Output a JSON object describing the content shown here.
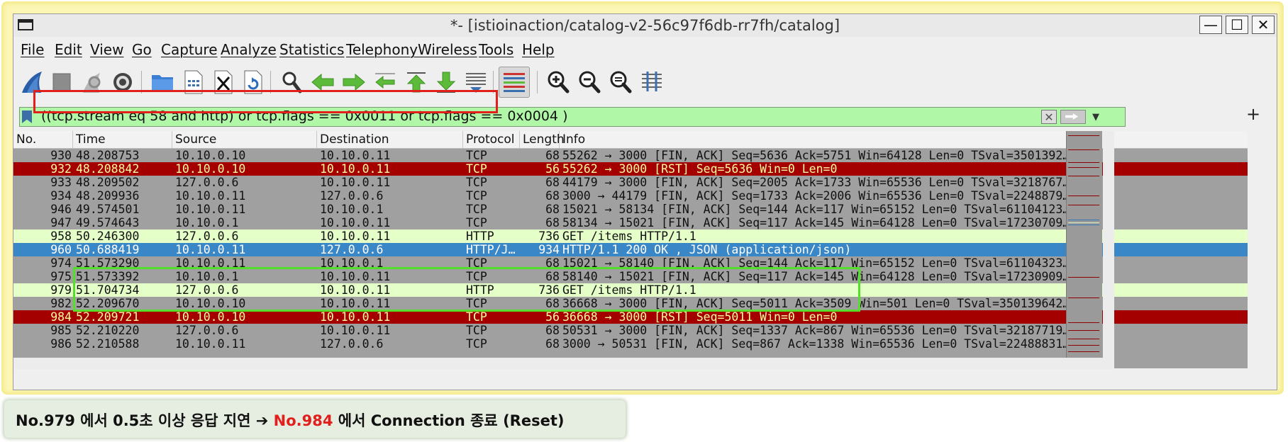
{
  "window": {
    "title": "*- [istioinaction/catalog-v2-56c97f6db-rr7fh/catalog]",
    "buttons": {
      "minimize": "—",
      "maximize": "☐",
      "close": "✕"
    }
  },
  "menu": [
    "File",
    "Edit",
    "View",
    "Go",
    "Capture",
    "Analyze",
    "Statistics",
    "Telephony",
    "Wireless",
    "Tools",
    "Help"
  ],
  "toolbar": {
    "icons": [
      "shark-fin-start-icon",
      "stop-icon",
      "restart-icon",
      "options-gear-icon",
      "open-folder-icon",
      "save-file-icon",
      "close-file-icon",
      "reload-icon",
      "find-icon",
      "back-arrow-icon",
      "forward-arrow-icon",
      "go-to-packet-icon",
      "first-packet-icon",
      "last-packet-icon",
      "autoscroll-icon",
      "colorize-icon",
      "zoom-in-icon",
      "zoom-out-icon",
      "normal-size-icon",
      "resize-columns-icon"
    ]
  },
  "filter": {
    "text": "((tcp.stream eq 58 and http) or tcp.flags == 0x0011 or tcp.flags == 0x0004 )",
    "plus": "+"
  },
  "columns": [
    "No.",
    "Time",
    "Source",
    "Destination",
    "Protocol",
    "Length",
    "Info"
  ],
  "packets": [
    {
      "no": "930",
      "time": "48.208753",
      "src": "10.10.0.10",
      "dst": "10.10.0.11",
      "proto": "TCP",
      "len": "68",
      "info": "55262 → 3000 [FIN, ACK] Seq=5636 Ack=5751 Win=64128 Len=0 TSval=3501392…",
      "style": "gray"
    },
    {
      "no": "932",
      "time": "48.208842",
      "src": "10.10.0.10",
      "dst": "10.10.0.11",
      "proto": "TCP",
      "len": "56",
      "info": "55262 → 3000 [RST] Seq=5636 Win=0 Len=0",
      "style": "red"
    },
    {
      "no": "933",
      "time": "48.209502",
      "src": "127.0.0.6",
      "dst": "10.10.0.11",
      "proto": "TCP",
      "len": "68",
      "info": "44179 → 3000 [FIN, ACK] Seq=2005 Ack=1733 Win=65536 Len=0 TSval=3218767…",
      "style": "gray"
    },
    {
      "no": "934",
      "time": "48.209936",
      "src": "10.10.0.11",
      "dst": "127.0.0.6",
      "proto": "TCP",
      "len": "68",
      "info": "3000 → 44179 [FIN, ACK] Seq=1733 Ack=2006 Win=65536 Len=0 TSval=2248879…",
      "style": "gray"
    },
    {
      "no": "946",
      "time": "49.574501",
      "src": "10.10.0.11",
      "dst": "10.10.0.1",
      "proto": "TCP",
      "len": "68",
      "info": "15021 → 58134 [FIN, ACK] Seq=144 Ack=117 Win=65152 Len=0 TSval=61104123…",
      "style": "gray"
    },
    {
      "no": "947",
      "time": "49.574643",
      "src": "10.10.0.1",
      "dst": "10.10.0.11",
      "proto": "TCP",
      "len": "68",
      "info": "58134 → 15021 [FIN, ACK] Seq=117 Ack=145 Win=64128 Len=0 TSval=17230709…",
      "style": "gray"
    },
    {
      "no": "958",
      "time": "50.246300",
      "src": "127.0.0.6",
      "dst": "10.10.0.11",
      "proto": "HTTP",
      "len": "736",
      "info": "GET /items HTTP/1.1",
      "style": "green"
    },
    {
      "no": "960",
      "time": "50.688419",
      "src": "10.10.0.11",
      "dst": "127.0.0.6",
      "proto": "HTTP/J…",
      "len": "934",
      "info": "HTTP/1.1 200 OK , JSON (application/json)",
      "style": "selected"
    },
    {
      "no": "974",
      "time": "51.573290",
      "src": "10.10.0.11",
      "dst": "10.10.0.1",
      "proto": "TCP",
      "len": "68",
      "info": "15021 → 58140 [FIN, ACK] Seq=144 Ack=117 Win=65152 Len=0 TSval=61104323…",
      "style": "gray"
    },
    {
      "no": "975",
      "time": "51.573392",
      "src": "10.10.0.1",
      "dst": "10.10.0.11",
      "proto": "TCP",
      "len": "68",
      "info": "58140 → 15021 [FIN, ACK] Seq=117 Ack=145 Win=64128 Len=0 TSval=17230909…",
      "style": "gray"
    },
    {
      "no": "979",
      "time": "51.704734",
      "src": "127.0.0.6",
      "dst": "10.10.0.11",
      "proto": "HTTP",
      "len": "736",
      "info": "GET /items HTTP/1.1",
      "style": "green"
    },
    {
      "no": "982",
      "time": "52.209670",
      "src": "10.10.0.10",
      "dst": "10.10.0.11",
      "proto": "TCP",
      "len": "68",
      "info": "36668 → 3000 [FIN, ACK] Seq=5011 Ack=3509 Win=501 Len=0 TSval=350139642…",
      "style": "gray"
    },
    {
      "no": "984",
      "time": "52.209721",
      "src": "10.10.0.10",
      "dst": "10.10.0.11",
      "proto": "TCP",
      "len": "56",
      "info": "36668 → 3000 [RST] Seq=5011 Win=0 Len=0",
      "style": "red"
    },
    {
      "no": "985",
      "time": "52.210220",
      "src": "127.0.0.6",
      "dst": "10.10.0.11",
      "proto": "TCP",
      "len": "68",
      "info": "50531 → 3000 [FIN, ACK] Seq=1337 Ack=867 Win=65536 Len=0 TSval=32187719…",
      "style": "gray"
    },
    {
      "no": "986",
      "time": "52.210588",
      "src": "10.10.0.11",
      "dst": "127.0.0.6",
      "proto": "TCP",
      "len": "68",
      "info": "3000 → 50531 [FIN, ACK] Seq=867 Ack=1338 Win=65536 Len=0 TSval=22488831…",
      "style": "gray"
    }
  ],
  "caption": {
    "part1": "No.979 에서 0.5초 이상 응답 지연 ➔ ",
    "part2": "No.984",
    "part3": " 에서 Connection 종료 (Reset)"
  },
  "colors": {
    "gray_row": "#a0a0a0",
    "red_row": "#a40000",
    "red_row_text": "#fffc9c",
    "green_row": "#e4ffc7",
    "selected_row": "#3a87c8",
    "filter_bg": "#b0f7a8",
    "highlight_red": "#e2201b",
    "highlight_green": "#54e02a"
  }
}
